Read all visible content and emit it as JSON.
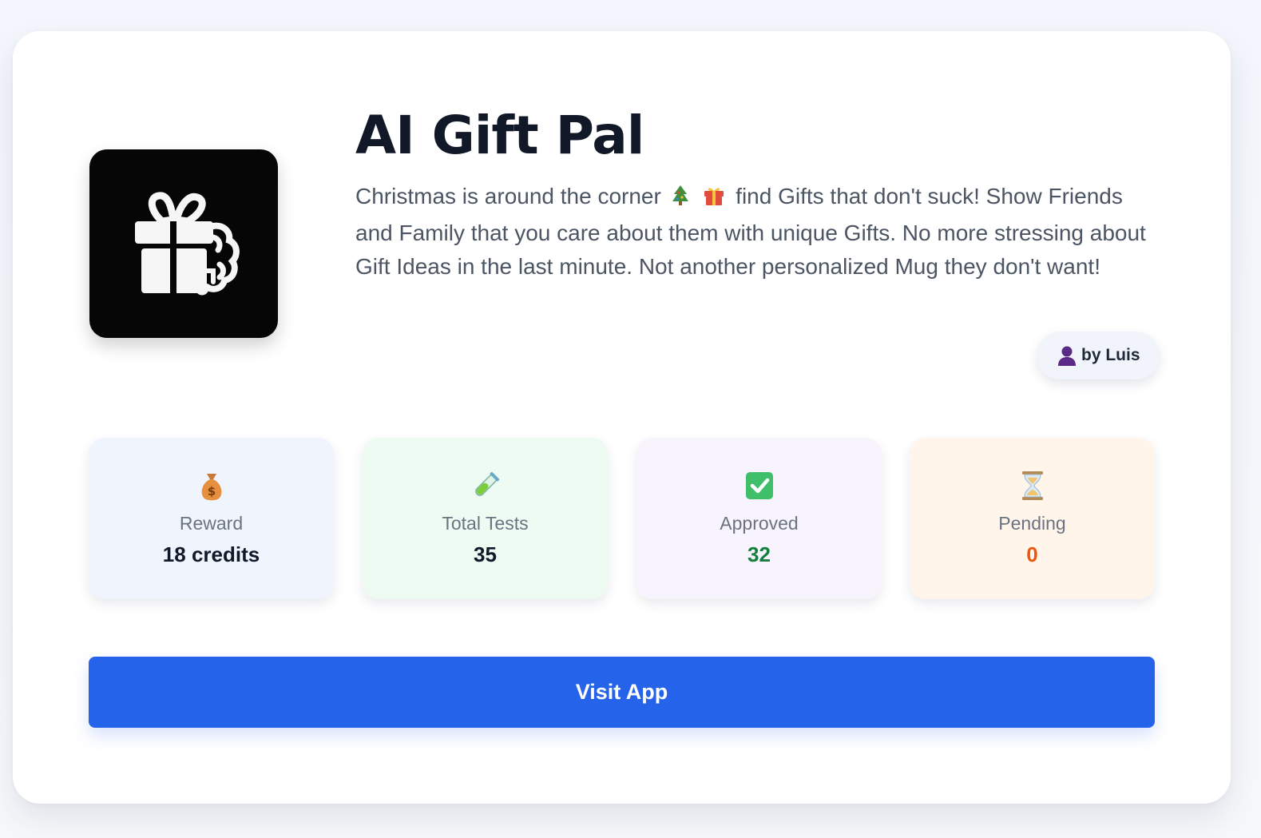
{
  "app": {
    "title": "AI Gift Pal",
    "icon": "gift-brain-icon",
    "description_part1": "Christmas is around the corner",
    "description_part2": "find Gifts that don't suck! Show Friends and Family that you care about them with unique Gifts. No more stressing about Gift Ideas in the last minute. Not another personalized Mug they don't want!",
    "description_emojis": [
      "christmas-tree-icon",
      "gift-icon"
    ],
    "author": "by Luis",
    "author_icon": "person-icon"
  },
  "stats": [
    {
      "icon": "money-bag-icon",
      "label": "Reward",
      "value": "18 credits",
      "color": "#111827"
    },
    {
      "icon": "test-tube-icon",
      "label": "Total Tests",
      "value": "35",
      "color": "#111827"
    },
    {
      "icon": "check-box-icon",
      "label": "Approved",
      "value": "32",
      "color": "#15803d"
    },
    {
      "icon": "hourglass-icon",
      "label": "Pending",
      "value": "0",
      "color": "#ea580c"
    }
  ],
  "actions": {
    "visit_label": "Visit App",
    "visit_color": "#2563eb"
  }
}
